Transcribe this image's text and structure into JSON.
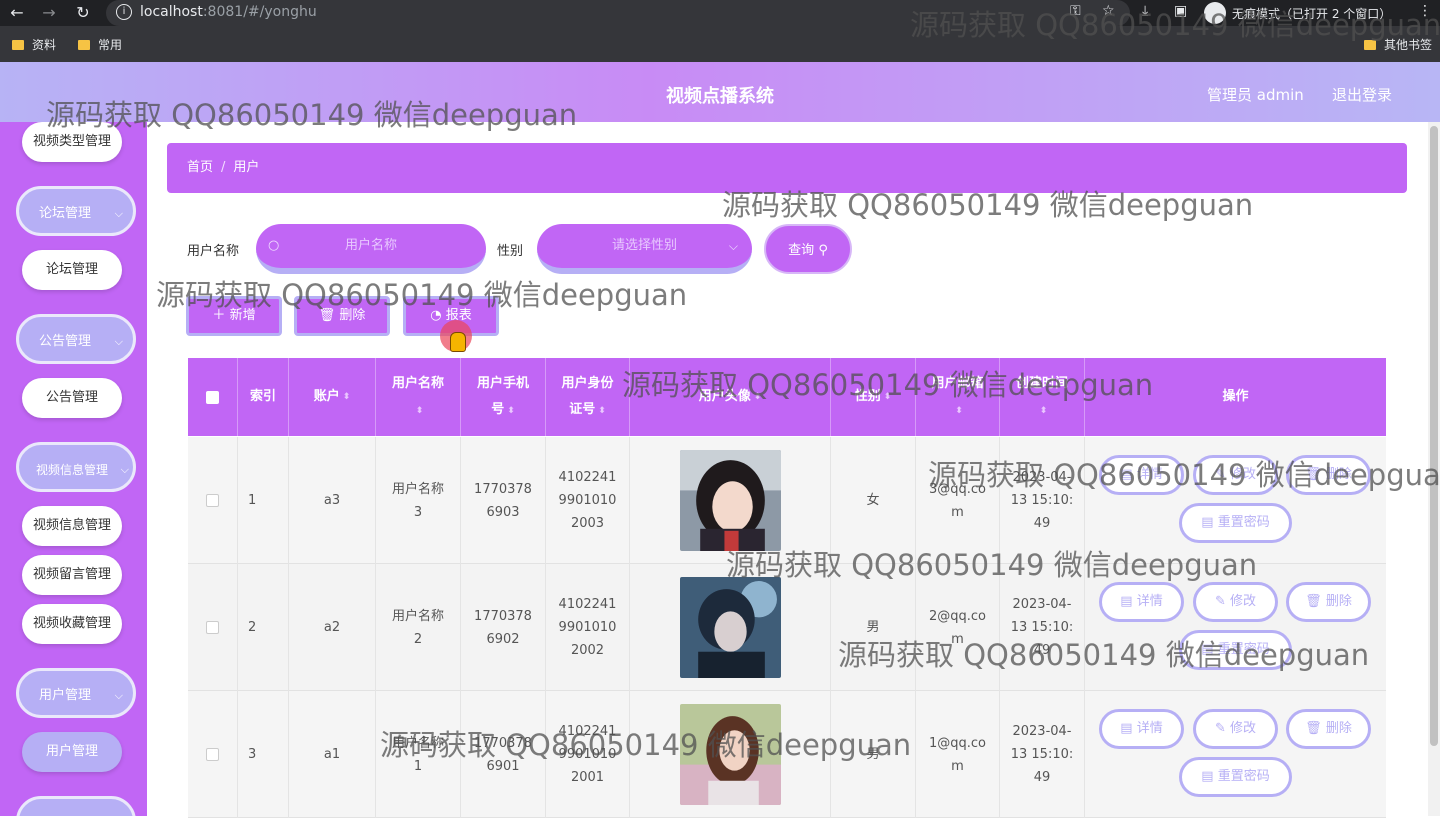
{
  "browser": {
    "url_host": "localhost",
    "url_rest": ":8081/#/yonghu",
    "incognito_label": "无痕模式（已打开 2 个窗口）",
    "bookmarks": [
      "资料",
      "常用"
    ],
    "other_bookmarks": "其他书签"
  },
  "header": {
    "title": "视频点播系统",
    "admin": "管理员 admin",
    "logout": "退出登录"
  },
  "sidebar": {
    "items": [
      {
        "label": "视频类型管理",
        "kind": "sub"
      },
      {
        "label": "论坛管理",
        "kind": "group"
      },
      {
        "label": "论坛管理",
        "kind": "sub"
      },
      {
        "label": "公告管理",
        "kind": "group"
      },
      {
        "label": "公告管理",
        "kind": "sub"
      },
      {
        "label": "视频信息管理",
        "kind": "group"
      },
      {
        "label": "视频信息管理",
        "kind": "sub"
      },
      {
        "label": "视频留言管理",
        "kind": "sub"
      },
      {
        "label": "视频收藏管理",
        "kind": "sub"
      },
      {
        "label": "用户管理",
        "kind": "group"
      },
      {
        "label": "用户管理",
        "kind": "sub-active"
      }
    ]
  },
  "breadcrumb": {
    "home": "首页",
    "sep": "/",
    "current": "用户"
  },
  "search": {
    "username_label": "用户名称",
    "username_placeholder": "用户名称",
    "gender_label": "性别",
    "gender_placeholder": "请选择性别",
    "query_button": "查询"
  },
  "actions": {
    "add": "新增",
    "delete": "删除",
    "report": "报表"
  },
  "table": {
    "columns": [
      "索引",
      "账户",
      "用户名称",
      "用户手机号",
      "用户身份证号",
      "用户头像",
      "性别",
      "用户邮箱",
      "创建时间",
      "操作"
    ],
    "rows": [
      {
        "index": "1",
        "account": "a3",
        "name": "用户名称3",
        "phone": "17703786903",
        "idcard": "410224199010102003",
        "gender": "女",
        "email": "3@qq.com",
        "created": "2023-04-13 15:10:49"
      },
      {
        "index": "2",
        "account": "a2",
        "name": "用户名称2",
        "phone": "17703786902",
        "idcard": "410224199010102002",
        "gender": "男",
        "email": "2@qq.com",
        "created": "2023-04-13 15:10:49"
      },
      {
        "index": "3",
        "account": "a1",
        "name": "用户名称1",
        "phone": "17703786901",
        "idcard": "410224199010102001",
        "gender": "男",
        "email": "1@qq.com",
        "created": "2023-04-13 15:10:49"
      }
    ],
    "row_ops": {
      "detail": "详情",
      "edit": "修改",
      "delete": "删除",
      "reset": "重置密码"
    }
  },
  "watermark": "源码获取 QQ86050149 微信deepguan",
  "colors": {
    "primary": "#c166f5",
    "secondary": "#b6aff5"
  }
}
